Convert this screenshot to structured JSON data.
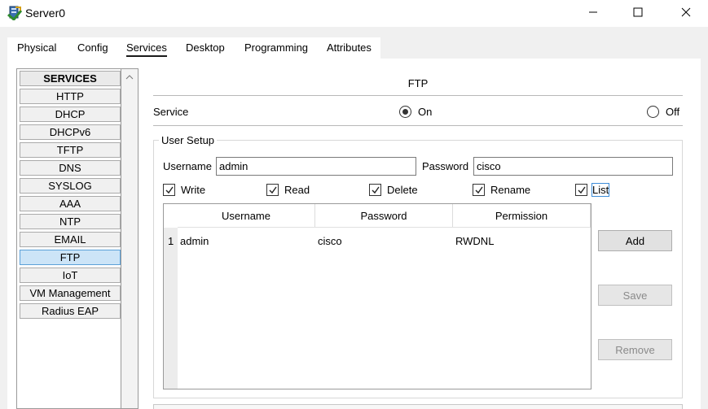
{
  "window": {
    "title": "Server0",
    "app_icon": "packet-tracer-server-icon",
    "controls": [
      "minimize-icon",
      "maximize-icon",
      "close-icon"
    ]
  },
  "tabs": [
    {
      "label": "Physical"
    },
    {
      "label": "Config"
    },
    {
      "label": "Services",
      "active": true
    },
    {
      "label": "Desktop"
    },
    {
      "label": "Programming"
    },
    {
      "label": "Attributes"
    }
  ],
  "sidebar": {
    "header": "SERVICES",
    "items": [
      {
        "label": "HTTP"
      },
      {
        "label": "DHCP"
      },
      {
        "label": "DHCPv6"
      },
      {
        "label": "TFTP"
      },
      {
        "label": "DNS"
      },
      {
        "label": "SYSLOG"
      },
      {
        "label": "AAA"
      },
      {
        "label": "NTP"
      },
      {
        "label": "EMAIL"
      },
      {
        "label": "FTP",
        "selected": true
      },
      {
        "label": "IoT"
      },
      {
        "label": "VM Management"
      },
      {
        "label": "Radius EAP"
      }
    ]
  },
  "ftp": {
    "title": "FTP",
    "service_label": "Service",
    "on_label": "On",
    "off_label": "Off",
    "service_state": "On",
    "user_setup": {
      "label": "User Setup",
      "username_label": "Username",
      "username_value": "admin",
      "password_label": "Password",
      "password_value": "cisco",
      "permissions": [
        {
          "label": "Write",
          "checked": true
        },
        {
          "label": "Read",
          "checked": true
        },
        {
          "label": "Delete",
          "checked": true
        },
        {
          "label": "Rename",
          "checked": true
        },
        {
          "label": "List",
          "checked": true
        }
      ]
    },
    "table": {
      "columns": [
        "Username",
        "Password",
        "Permission"
      ],
      "rows": [
        {
          "num": "1",
          "username": "admin",
          "password": "cisco",
          "permission": "RWDNL"
        }
      ]
    },
    "buttons": {
      "add": "Add",
      "save": "Save",
      "remove": "Remove"
    }
  }
}
